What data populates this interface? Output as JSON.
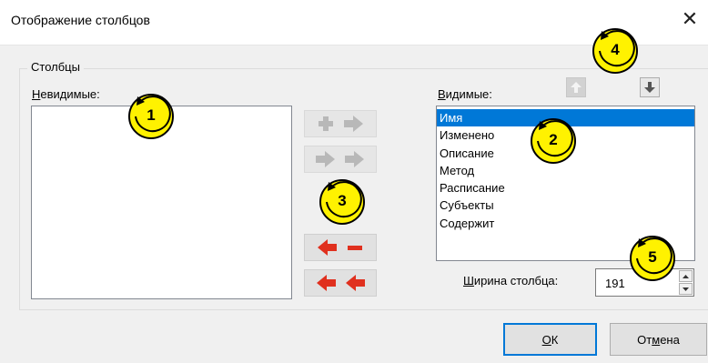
{
  "dialog": {
    "title": "Отображение столбцов",
    "close_glyph": "✕"
  },
  "group": {
    "label": "Столбцы"
  },
  "invisible": {
    "label_access": "Н",
    "label_rest": "евидимые:",
    "items": []
  },
  "visible": {
    "label_access": "В",
    "label_rest": "идимые:",
    "items": [
      "Имя",
      "Изменено",
      "Описание",
      "Метод",
      "Расписание",
      "Субъекты",
      "Содержит"
    ],
    "selected": "Имя"
  },
  "transfer_buttons": [
    {
      "name": "add-selected",
      "icons": [
        "plus-icon",
        "arrow-right-icon"
      ],
      "enabled": false
    },
    {
      "name": "add-all",
      "icons": [
        "arrow-right-icon",
        "arrow-right-icon"
      ],
      "enabled": false
    },
    {
      "name": "remove-selected",
      "icons": [
        "arrow-left-icon",
        "minus-icon"
      ],
      "enabled": true
    },
    {
      "name": "remove-all",
      "icons": [
        "arrow-left-icon",
        "arrow-left-icon"
      ],
      "enabled": true
    }
  ],
  "order_buttons": {
    "up": {
      "icon": "arrow-up-icon",
      "enabled": false
    },
    "down": {
      "icon": "arrow-down-icon",
      "enabled": true
    }
  },
  "column_width": {
    "label_access": "Ш",
    "label_rest": "ирина столбца:",
    "value": "191"
  },
  "buttons": {
    "ok_access": "О",
    "ok_rest": "К",
    "cancel_pre": "От",
    "cancel_access": "м",
    "cancel_rest": "ена"
  },
  "callouts": [
    "1",
    "2",
    "3",
    "4",
    "5"
  ],
  "colors": {
    "accent": "#0078d7",
    "callout_fill": "#fff200",
    "arrow_red": "#e0301e",
    "arrow_disabled": "#b8b8b8"
  }
}
